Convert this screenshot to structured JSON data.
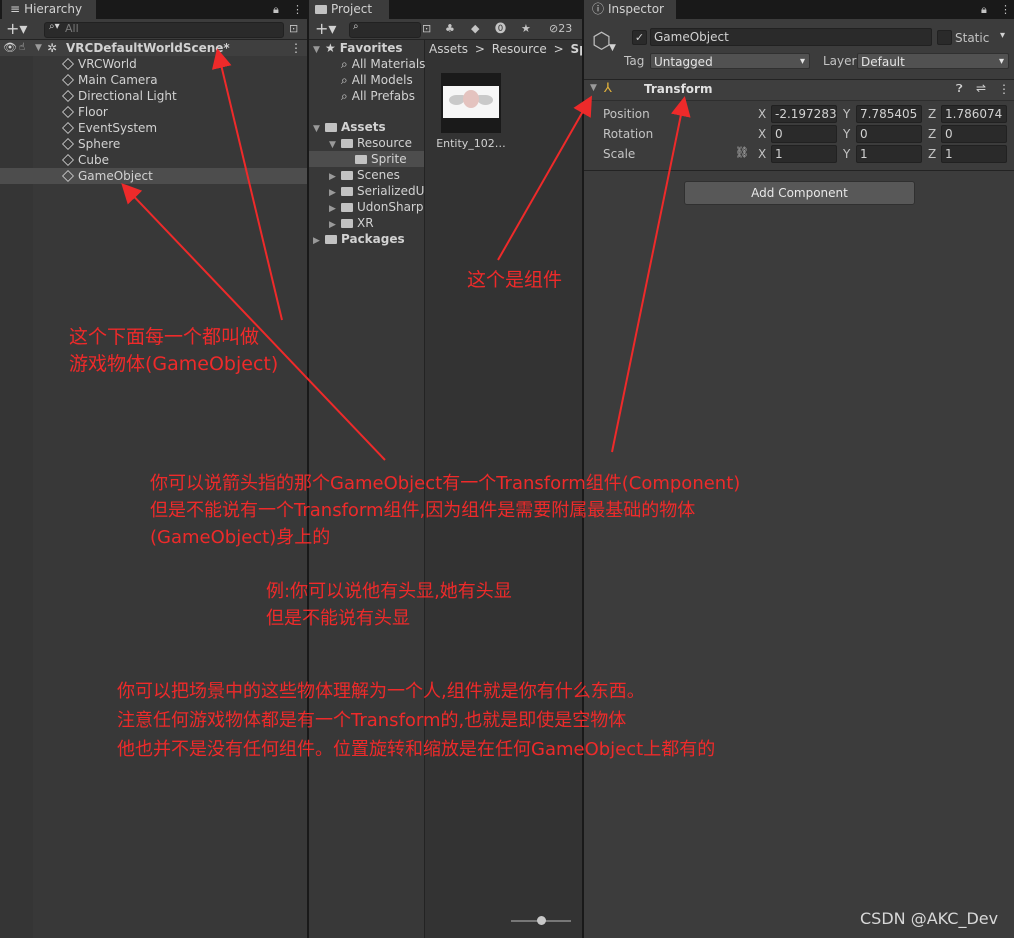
{
  "hierarchy": {
    "tab": "Hierarchy",
    "search_placeholder": "All",
    "scene": "VRCDefaultWorldScene*",
    "items": [
      "VRCWorld",
      "Main Camera",
      "Directional Light",
      "Floor",
      "EventSystem",
      "Sphere",
      "Cube",
      "GameObject"
    ],
    "selected": "GameObject"
  },
  "project": {
    "tab": "Project",
    "favorites_label": "Favorites",
    "favorites": [
      "All Materials",
      "All Models",
      "All Prefabs"
    ],
    "assets_label": "Assets",
    "folders": [
      "Resource",
      "Sprite",
      "Scenes",
      "SerializedU",
      "UdonSharp",
      "XR"
    ],
    "packages_label": "Packages",
    "breadcrumb": [
      "Assets",
      "Resource",
      "Sprit"
    ],
    "hidden_count": "23",
    "asset_name": "Entity_102…"
  },
  "inspector": {
    "tab": "Inspector",
    "object_name": "GameObject",
    "active_checked": true,
    "static_label": "Static",
    "tag_label": "Tag",
    "tag_value": "Untagged",
    "layer_label": "Layer",
    "layer_value": "Default",
    "component_title": "Transform",
    "rows": [
      {
        "label": "Position",
        "x": "-2.197283",
        "y": "7.785405",
        "z": "1.786074"
      },
      {
        "label": "Rotation",
        "x": "0",
        "y": "0",
        "z": "0"
      },
      {
        "label": "Scale",
        "x": "1",
        "y": "1",
        "z": "1"
      }
    ],
    "axis_x": "X",
    "axis_y": "Y",
    "axis_z": "Z",
    "add_component": "Add Component"
  },
  "annotations": {
    "component": "这个是组件",
    "gameobjects": [
      "这个下面每一个都叫做",
      "游戏物体(GameObject)"
    ],
    "explain": [
      "你可以说箭头指的那个GameObject有一个Transform组件(Component)",
      "但是不能说有一个Transform组件,因为组件是需要附属最基础的物体",
      "(GameObject)身上的"
    ],
    "example": [
      "例:你可以说他有头显,她有头显",
      "但是不能说有头显"
    ],
    "summary": [
      "你可以把场景中的这些物体理解为一个人,组件就是你有什么东西。",
      "注意任何游戏物体都是有一个Transform的,也就是即使是空物体",
      "他也并不是没有任何组件。位置旋转和缩放是在任何GameObject上都有的"
    ]
  },
  "watermark": "CSDN @AKC_Dev",
  "colors": {
    "annotation": "#ee2a2a",
    "selection": "#4d4d4d",
    "panel": "#383838"
  }
}
